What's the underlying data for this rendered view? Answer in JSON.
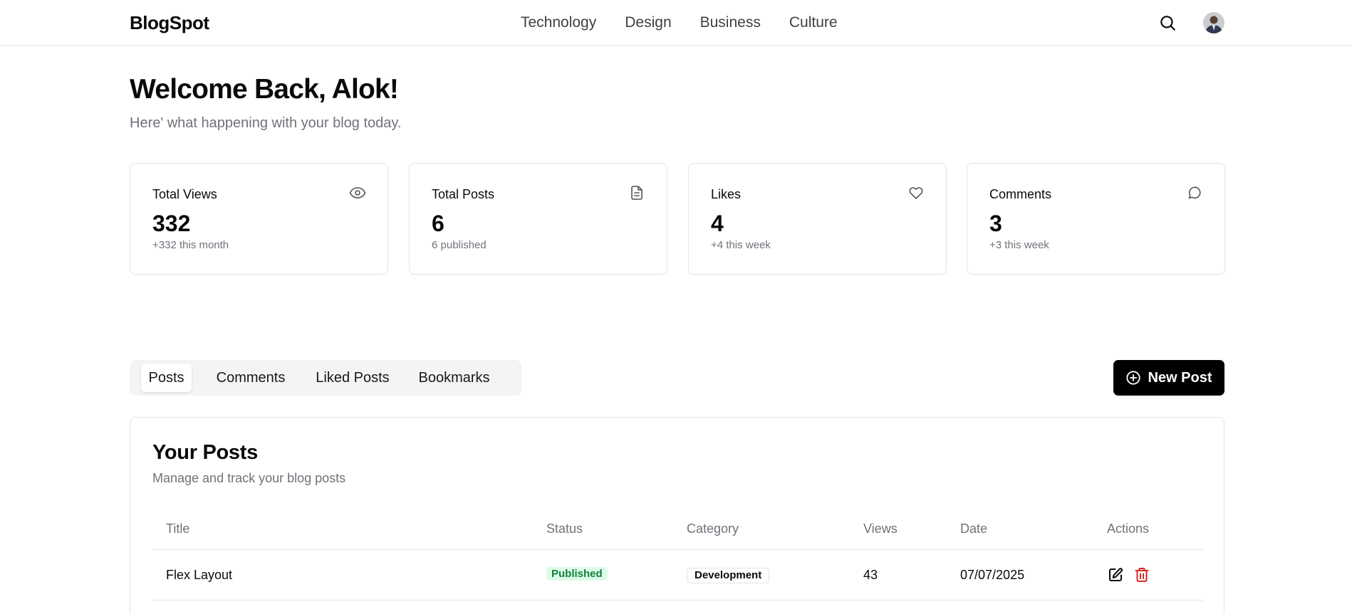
{
  "header": {
    "brand": "BlogSpot",
    "nav": [
      "Technology",
      "Design",
      "Business",
      "Culture"
    ],
    "search_icon": "search-icon",
    "avatar": "user-avatar"
  },
  "welcome": {
    "title": "Welcome Back, Alok!",
    "subtitle": "Here' what happening with your blog today."
  },
  "stats": [
    {
      "title": "Total Views",
      "value": "332",
      "note": "+332 this month",
      "icon": "eye-icon"
    },
    {
      "title": "Total Posts",
      "value": "6",
      "note": "6 published",
      "icon": "document-icon"
    },
    {
      "title": "Likes",
      "value": "4",
      "note": "+4 this week",
      "icon": "heart-icon"
    },
    {
      "title": "Comments",
      "value": "3",
      "note": "+3 this week",
      "icon": "message-icon"
    }
  ],
  "tabs": [
    "Posts",
    "Comments",
    "Liked Posts",
    "Bookmarks"
  ],
  "active_tab": "Posts",
  "new_post_label": "New Post",
  "posts": {
    "title": "Your Posts",
    "subtitle": "Manage and track your blog posts",
    "columns": [
      "Title",
      "Status",
      "Category",
      "Views",
      "Date",
      "Actions"
    ],
    "rows": [
      {
        "title": "Flex Layout",
        "status": "Published",
        "category": "Development",
        "views": "43",
        "date": "07/07/2025"
      }
    ]
  },
  "colors": {
    "primary": "#000000",
    "published_bg": "#dcfce7",
    "published_text": "#15803d",
    "delete": "#dc2626",
    "muted_text": "#71717a",
    "border": "#e4e4e7"
  }
}
